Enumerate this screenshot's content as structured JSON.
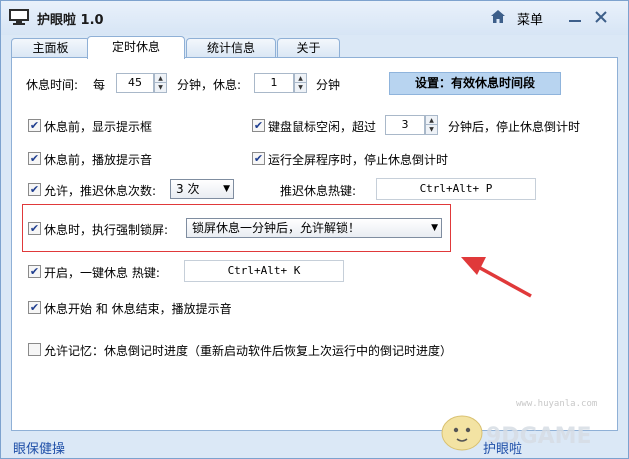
{
  "window": {
    "title": "护眼啦 1.0",
    "menu_label": "菜单"
  },
  "tabs": [
    {
      "label": "主面板"
    },
    {
      "label": "定时休息"
    },
    {
      "label": "统计信息"
    },
    {
      "label": "关于"
    }
  ],
  "rest": {
    "interval_label": "休息时间:",
    "every_label": "每",
    "minutes_value": "45",
    "minutes_rest_label": "分钟，休息:",
    "rest_value": "1",
    "minutes_label": "分钟",
    "settings_button": "设置：有效休息时间段"
  },
  "options": {
    "show_prompt": {
      "label": "休息前，显示提示框",
      "checked": true
    },
    "idle_detect": {
      "label": "键盘鼠标空闲，超过",
      "checked": true,
      "value": "3",
      "suffix": "分钟后，停止休息倒计时"
    },
    "play_sound": {
      "label": "休息前，播放提示音",
      "checked": true
    },
    "fullscreen_stop": {
      "label": "运行全屏程序时，停止休息倒计时",
      "checked": true
    },
    "allow_delay": {
      "label": "允许，推迟休息次数:",
      "checked": true,
      "select_value": "3 次"
    },
    "delay_hotkey_label": "推迟休息热键:",
    "delay_hotkey_value": "Ctrl+Alt+ P",
    "force_lock": {
      "label": "休息时，执行强制锁屏:",
      "checked": true,
      "select_value": "锁屏休息一分钟后，允许解锁！"
    },
    "one_key": {
      "label": "开启，一键休息 热键:",
      "checked": true,
      "hotkey_value": "Ctrl+Alt+ K"
    },
    "start_end_sound": {
      "label": "休息开始 和 休息结束，播放提示音",
      "checked": true
    },
    "memory": {
      "label": "允许记忆：休息倒记时进度（重新启动软件后恢复上次运行中的倒记时进度）",
      "checked": false
    }
  },
  "footer": {
    "left_link": "眼保健操",
    "right_text": "护眼啦"
  },
  "watermark": {
    "url": "www.huyanla.com",
    "brand": "9DGAME"
  },
  "colors": {
    "accent_red": "#e0393a",
    "link_blue": "#1f4fa8"
  },
  "icons": {
    "app": "monitor-icon",
    "home": "home-icon",
    "minimize": "minimize-icon",
    "close": "close-icon",
    "check": "check-icon",
    "dropdown": "chevron-down-icon"
  }
}
